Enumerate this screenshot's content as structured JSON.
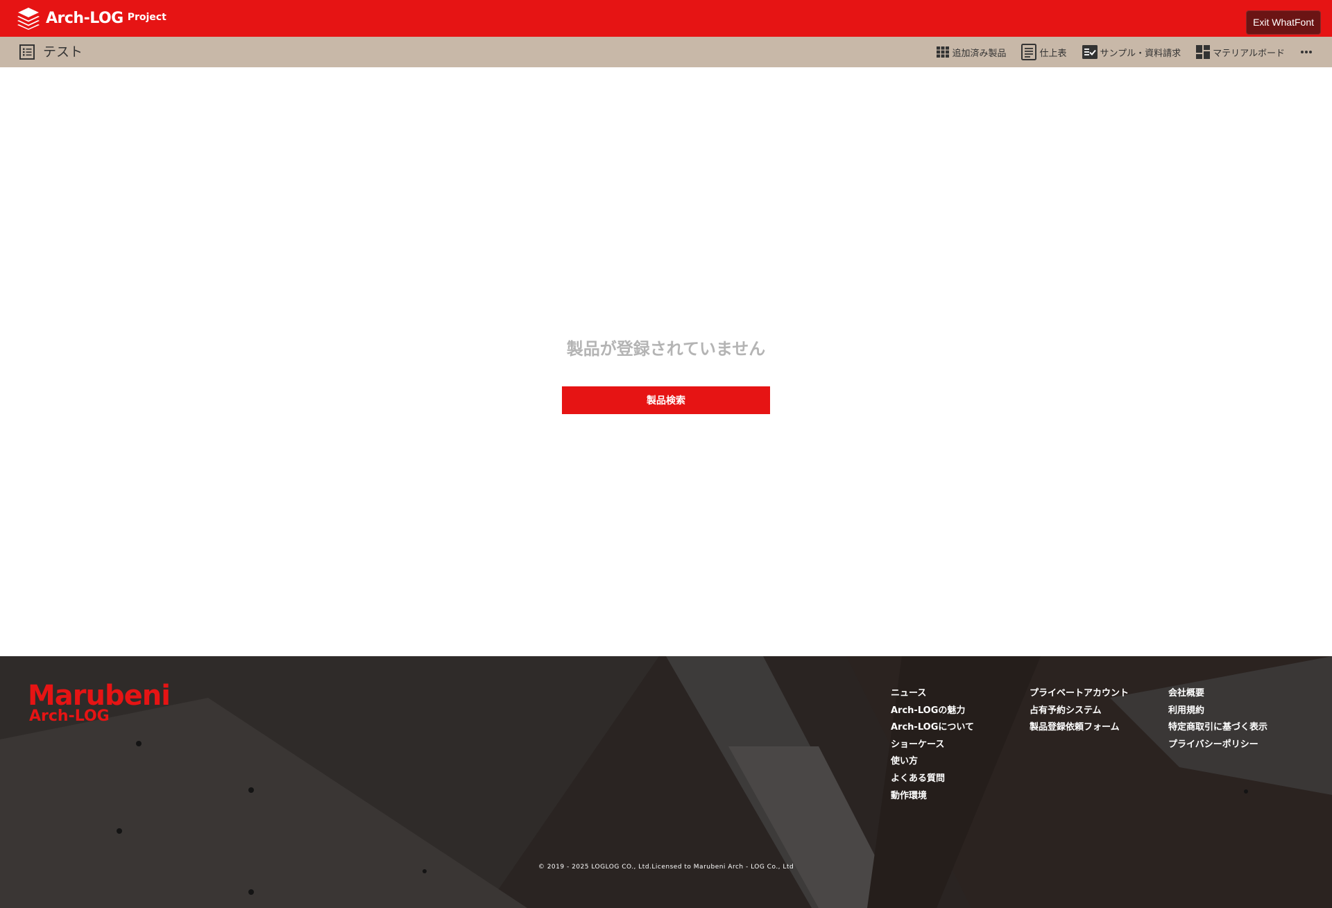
{
  "header": {
    "logo_text": "Arch-LOG",
    "logo_sub": "Project",
    "exit_whatfont": "Exit WhatFont"
  },
  "subbar": {
    "project_name": "テスト",
    "nav": [
      {
        "label": "追加済み製品",
        "icon": "grid-icon"
      },
      {
        "label": "仕上表",
        "icon": "document-icon"
      },
      {
        "label": "サンプル・資料請求",
        "icon": "checklist-icon"
      },
      {
        "label": "マテリアルボード",
        "icon": "board-icon"
      }
    ],
    "more_icon": "more-icon"
  },
  "main": {
    "empty_message": "製品が登録されていません",
    "search_button": "製品検索"
  },
  "footer": {
    "brand_top": "Marubeni",
    "brand_bottom": "Arch-LOG",
    "col1": [
      "ニュース",
      "Arch-LOGの魅力",
      "Arch-LOGについて",
      "ショーケース",
      "使い方",
      "よくある質問",
      "動作環境"
    ],
    "col2": [
      "プライベートアカウント",
      "占有予約システム",
      "製品登録依頼フォーム"
    ],
    "col3": [
      "会社概要",
      "利用規約",
      "特定商取引に基づく表示",
      "プライバシーポリシー"
    ],
    "copyright": "© 2019 - 2025 LOGLOG CO., Ltd.Licensed to Marubeni Arch - LOG Co., Ltd"
  },
  "colors": {
    "brand_red": "#e61414",
    "subbar_beige": "#c8b8a8",
    "empty_text": "#b4b4b4",
    "footer_bg": "#241e1c"
  }
}
